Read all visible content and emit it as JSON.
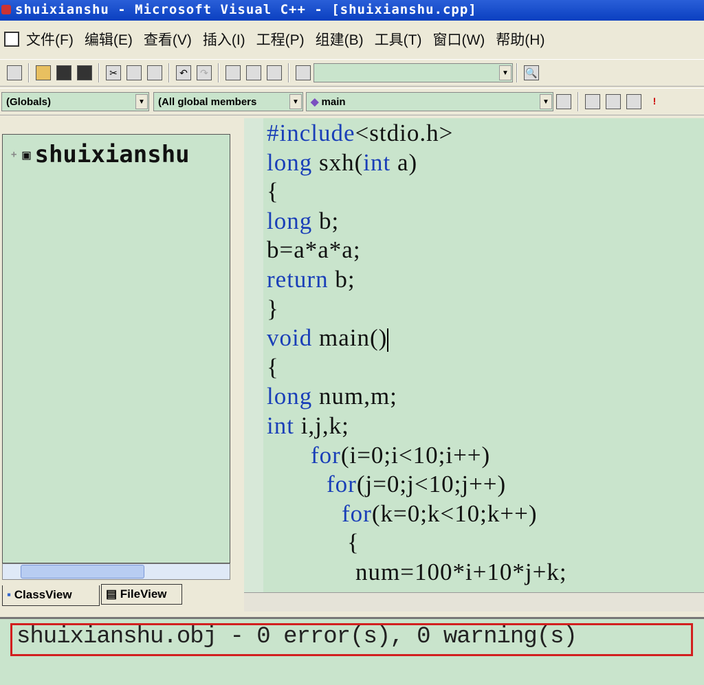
{
  "title": "shuixianshu - Microsoft Visual C++ - [shuixianshu.cpp]",
  "menu": [
    "文件(F)",
    "编辑(E)",
    "查看(V)",
    "插入(I)",
    "工程(P)",
    "组建(B)",
    "工具(T)",
    "窗口(W)",
    "帮助(H)"
  ],
  "toolbar": {
    "find_value": ""
  },
  "wizard": {
    "scope": "(Globals)",
    "filter": "(All global members",
    "member": "main"
  },
  "workspace": {
    "tree_root": "shuixianshu",
    "tabs": [
      "ClassView",
      "FileView"
    ]
  },
  "code": [
    {
      "indent": 0,
      "tokens": [
        {
          "t": "#include",
          "kw": true
        },
        {
          "t": "<stdio.h>"
        }
      ]
    },
    {
      "indent": 0,
      "tokens": [
        {
          "t": "long",
          "kw": true
        },
        {
          "t": " sxh("
        },
        {
          "t": "int",
          "kw": true
        },
        {
          "t": " a)"
        }
      ]
    },
    {
      "indent": 0,
      "tokens": [
        {
          "t": "{"
        }
      ]
    },
    {
      "indent": 0,
      "tokens": [
        {
          "t": "long",
          "kw": true
        },
        {
          "t": " b;"
        }
      ]
    },
    {
      "indent": 0,
      "tokens": [
        {
          "t": "b=a*a*a;"
        }
      ]
    },
    {
      "indent": 0,
      "tokens": [
        {
          "t": "return",
          "kw": true
        },
        {
          "t": " b;"
        }
      ]
    },
    {
      "indent": 0,
      "tokens": [
        {
          "t": "}"
        }
      ]
    },
    {
      "indent": 0,
      "tokens": [
        {
          "t": "void",
          "kw": true
        },
        {
          "t": " main()"
        }
      ],
      "caret": true
    },
    {
      "indent": 0,
      "tokens": [
        {
          "t": "{"
        }
      ]
    },
    {
      "indent": 0,
      "tokens": [
        {
          "t": "long",
          "kw": true
        },
        {
          "t": " num,m;"
        }
      ]
    },
    {
      "indent": 0,
      "tokens": [
        {
          "t": "int",
          "kw": true
        },
        {
          "t": " i,j,k;"
        }
      ]
    },
    {
      "indent": 64,
      "tokens": [
        {
          "t": "for",
          "kw": true
        },
        {
          "t": "(i=0;i<10;i++)"
        }
      ]
    },
    {
      "indent": 87,
      "tokens": [
        {
          "t": "for",
          "kw": true
        },
        {
          "t": "(j=0;j<10;j++)"
        }
      ]
    },
    {
      "indent": 109,
      "tokens": [
        {
          "t": "for",
          "kw": true
        },
        {
          "t": "(k=0;k<10;k++)"
        }
      ]
    },
    {
      "indent": 117,
      "tokens": [
        {
          "t": "{"
        }
      ]
    },
    {
      "indent": 129,
      "tokens": [
        {
          "t": "num=100*i+10*j+k;"
        }
      ]
    }
  ],
  "output": {
    "message": "shuixianshu.obj - 0 error(s), 0 warning(s)"
  },
  "colors": {
    "editor_bg": "#c9e4cc",
    "keyword": "#1a3fb8",
    "highlight": "#d21f1f"
  }
}
